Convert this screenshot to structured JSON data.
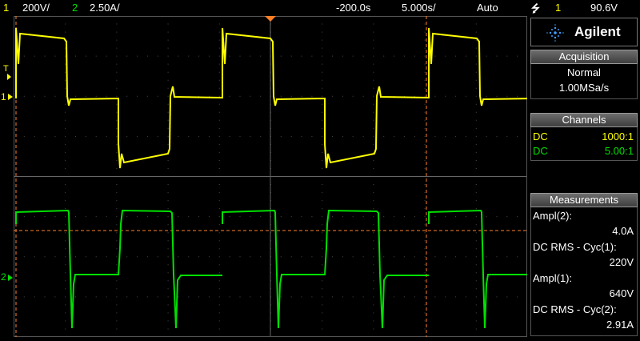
{
  "topbar": {
    "ch1_num": "1",
    "ch1_scale": "200V/",
    "ch2_num": "2",
    "ch2_scale": "2.50A/",
    "time_offset": "-200.0s",
    "time_scale": "5.000s/",
    "trigger_mode": "Auto",
    "trigger_source": "1",
    "trigger_level": "90.6V"
  },
  "brand": {
    "name": "Agilent"
  },
  "acquisition": {
    "title": "Acquisition",
    "mode": "Normal",
    "rate": "1.00MSa/s"
  },
  "channels": {
    "title": "Channels",
    "items": [
      {
        "coupling": "DC",
        "probe": "1000:1",
        "color": "#ffff00"
      },
      {
        "coupling": "DC",
        "probe": "5.00:1",
        "color": "#00e000"
      }
    ]
  },
  "measurements": {
    "title": "Measurements",
    "items": [
      {
        "label": "Ampl(2):",
        "value": "4.0A"
      },
      {
        "label": "DC RMS - Cyc(1):",
        "value": "220V"
      },
      {
        "label": "Ampl(1):",
        "value": "640V"
      },
      {
        "label": "DC RMS - Cyc(2):",
        "value": "2.91A"
      }
    ]
  },
  "markers": {
    "ch1": "1",
    "ch2": "2",
    "trig": "T"
  },
  "colors": {
    "ch1": "#ffff00",
    "ch2": "#00e000",
    "cursor": "#ff7f27",
    "grid": "#4a4a4a"
  }
}
